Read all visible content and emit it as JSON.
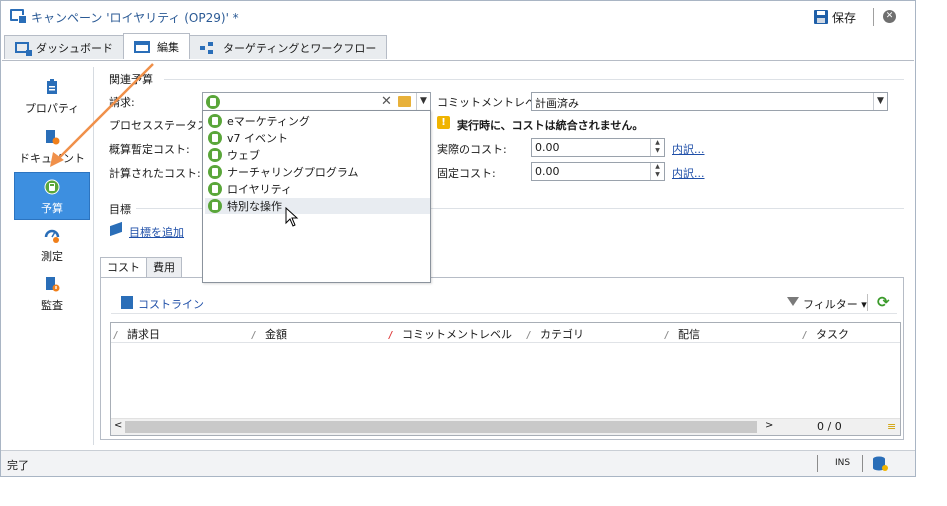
{
  "window": {
    "title": "キャンペーン 'ロイヤリティ (OP29)' *",
    "save_label": "保存"
  },
  "tabs": [
    {
      "label": "ダッシュボード",
      "icon": "dashboard-icon"
    },
    {
      "label": "編集",
      "icon": "edit-icon",
      "active": true
    },
    {
      "label": "ターゲティングとワークフロー",
      "icon": "workflow-icon"
    }
  ],
  "sidebar": {
    "items": [
      {
        "label": "プロパティ",
        "icon": "properties-icon"
      },
      {
        "label": "ドキュメント",
        "icon": "document-icon"
      },
      {
        "label": "予算",
        "icon": "budget-icon",
        "active": true
      },
      {
        "label": "測定",
        "icon": "measure-icon"
      },
      {
        "label": "監査",
        "icon": "audit-icon"
      }
    ]
  },
  "budget": {
    "section_title": "関連予算",
    "billing_label": "請求:",
    "billing_value": "",
    "commit_level_label": "コミットメントレベル:",
    "commit_level_value": "計画済み",
    "process_status_label": "プロセスステータス:",
    "warning_text": "実行時に、コストは統合されません。",
    "estimated_cost_label": "概算暫定コスト:",
    "calculated_cost_label": "計算されたコスト:",
    "actual_cost_label": "実際のコスト:",
    "actual_cost_value": "0.00",
    "fixed_cost_label": "固定コスト:",
    "fixed_cost_value": "0.00",
    "details_link": "内訳..."
  },
  "dropdown": {
    "items": [
      "eマーケティング",
      "v7 イベント",
      "ウェブ",
      "ナーチャリングプログラム",
      "ロイヤリティ",
      "特別な操作"
    ],
    "hover_index": 5
  },
  "goals": {
    "section_title": "目標",
    "add_link": "目標を追加"
  },
  "subtabs": [
    "コスト",
    "費用"
  ],
  "cost_panel": {
    "cost_lines_label": "コストライン",
    "filter_label": "フィルター",
    "columns": [
      "請求日",
      "金額",
      "コミットメントレベル",
      "カテゴリ",
      "配信",
      "タスク"
    ],
    "pager": "0 / 0"
  },
  "status": {
    "text": "完了",
    "mode": "INS"
  },
  "colors": {
    "accent": "#3d8fe0",
    "link": "#1f4fa8",
    "green": "#5aa63a",
    "callout_arrow": "#f0904a",
    "warning": "#f0b400"
  }
}
